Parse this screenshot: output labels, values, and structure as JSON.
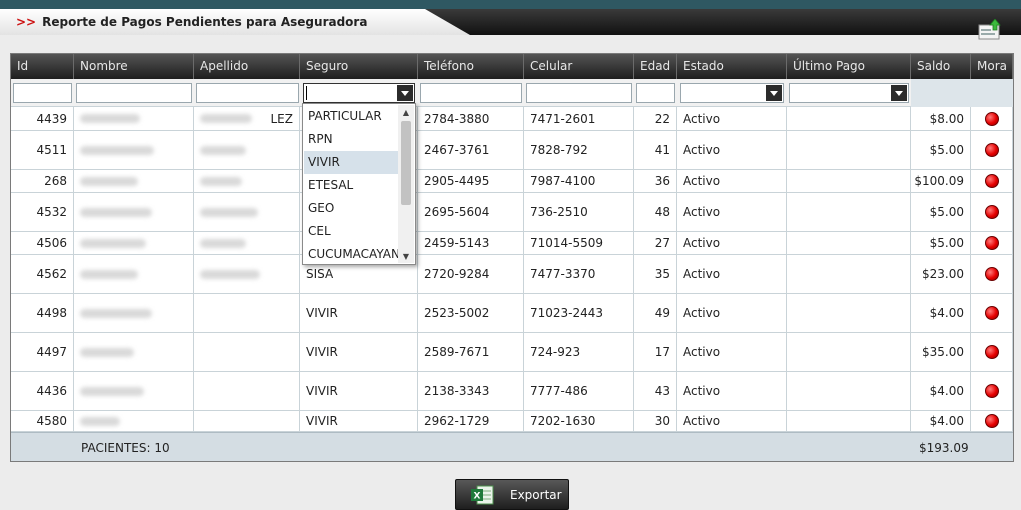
{
  "header": {
    "arrows": ">>",
    "title": "Reporte de Pagos Pendientes para Aseguradora"
  },
  "columns": [
    "Id",
    "Nombre",
    "Apellido",
    "Seguro",
    "Teléfono",
    "Celular",
    "Edad",
    "Estado",
    "Último Pago",
    "Saldo",
    "Mora"
  ],
  "rows": [
    {
      "id": "4439",
      "seguro": "",
      "telefono": "2784-3880",
      "celular": "7471-2601",
      "edad": "22",
      "estado": "Activo",
      "ultimo_pago": "",
      "saldo": "$8.00"
    },
    {
      "id": "4511",
      "seguro": "",
      "telefono": "2467-3761",
      "celular": "7828-792",
      "edad": "41",
      "estado": "Activo",
      "ultimo_pago": "",
      "saldo": "$5.00"
    },
    {
      "id": "268",
      "seguro": "",
      "telefono": "2905-4495",
      "celular": "7987-4100",
      "edad": "36",
      "estado": "Activo",
      "ultimo_pago": "",
      "saldo": "$100.09"
    },
    {
      "id": "4532",
      "seguro": "",
      "telefono": "2695-5604",
      "celular": "736-2510",
      "edad": "48",
      "estado": "Activo",
      "ultimo_pago": "",
      "saldo": "$5.00"
    },
    {
      "id": "4506",
      "seguro": "",
      "telefono": "2459-5143",
      "celular": "71014-5509",
      "edad": "27",
      "estado": "Activo",
      "ultimo_pago": "",
      "saldo": "$5.00"
    },
    {
      "id": "4562",
      "seguro": "SISA",
      "telefono": "2720-9284",
      "celular": "7477-3370",
      "edad": "35",
      "estado": "Activo",
      "ultimo_pago": "",
      "saldo": "$23.00"
    },
    {
      "id": "4498",
      "seguro": "VIVIR",
      "telefono": "2523-5002",
      "celular": "71023-2443",
      "edad": "49",
      "estado": "Activo",
      "ultimo_pago": "",
      "saldo": "$4.00"
    },
    {
      "id": "4497",
      "seguro": "VIVIR",
      "telefono": "2589-7671",
      "celular": "724-923",
      "edad": "17",
      "estado": "Activo",
      "ultimo_pago": "",
      "saldo": "$35.00"
    },
    {
      "id": "4436",
      "seguro": "VIVIR",
      "telefono": "2138-3343",
      "celular": "7777-486",
      "edad": "43",
      "estado": "Activo",
      "ultimo_pago": "",
      "saldo": "$4.00"
    },
    {
      "id": "4580",
      "seguro": "VIVIR",
      "telefono": "2962-1729",
      "celular": "7202-1630",
      "edad": "30",
      "estado": "Activo",
      "ultimo_pago": "",
      "saldo": "$4.00"
    }
  ],
  "row1_apellido_fragment": "LEZ",
  "seguro_dropdown": {
    "options": [
      "PARTICULAR",
      "RPN",
      "VIVIR",
      "ETESAL",
      "GEO",
      "CEL",
      "CUCUMACAYAN"
    ],
    "highlighted": "VIVIR"
  },
  "footer": {
    "pacientes": "PACIENTES: 10",
    "total": "$193.09"
  },
  "export_label": "Exportar",
  "colors": {
    "mora_indicator": "#e60000",
    "header_bg": "#2b2b2b",
    "title_arrows": "#cc1111",
    "footer_bg": "#d4dde3"
  },
  "icons": {
    "upload": "upload-icon",
    "excel": "excel-icon",
    "mora": "red-dot-icon"
  }
}
